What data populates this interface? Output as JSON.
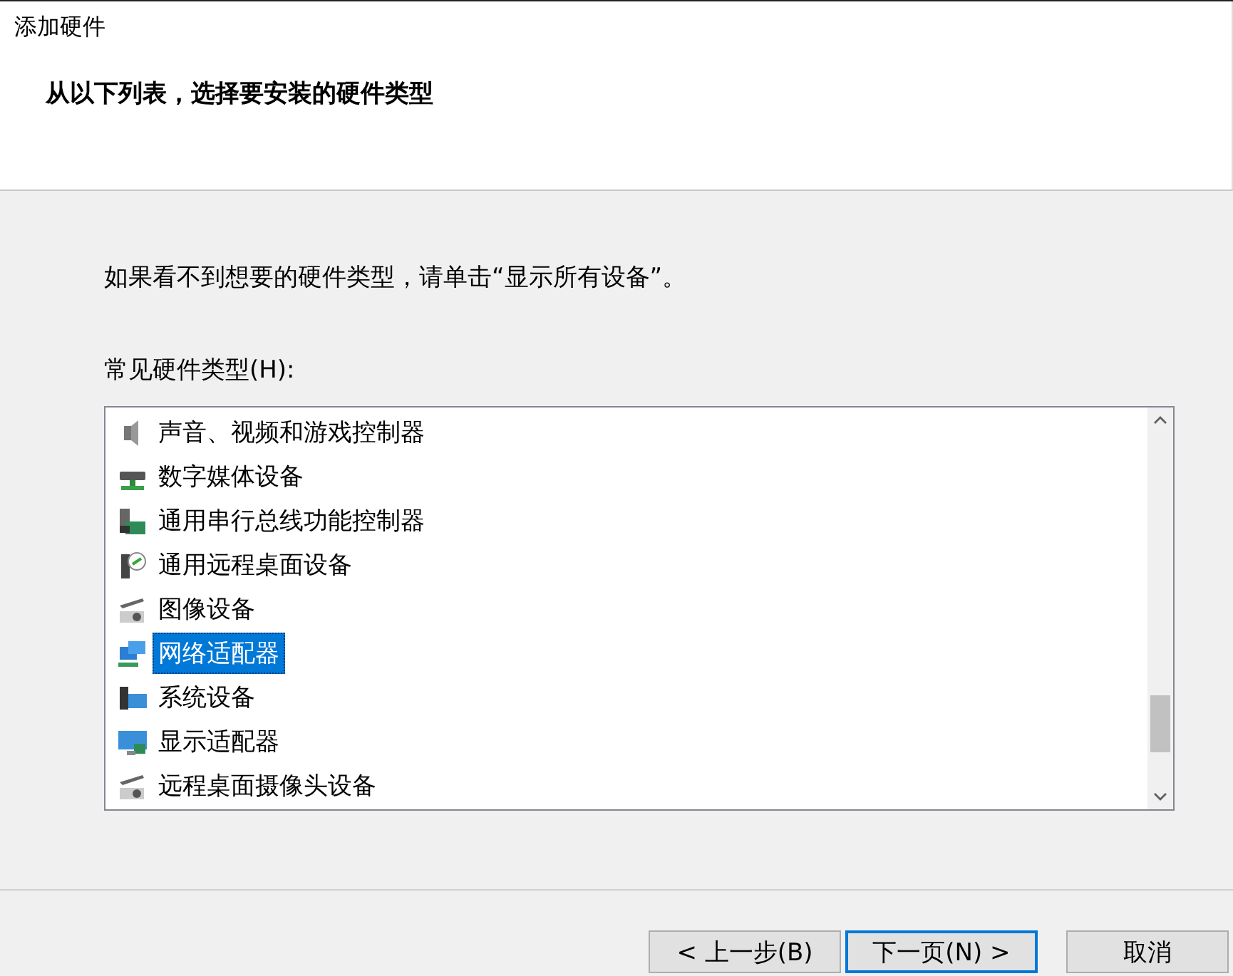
{
  "window": {
    "title": "添加硬件"
  },
  "header": {
    "heading": "从以下列表，选择要安装的硬件类型"
  },
  "hint": "如果看不到想要的硬件类型，请单击“显示所有设备”。",
  "list_label": "常见硬件类型(H):",
  "hardware_types": [
    {
      "label": "声音、视频和游戏控制器",
      "selected": false
    },
    {
      "label": "数字媒体设备",
      "selected": false
    },
    {
      "label": "通用串行总线功能控制器",
      "selected": false
    },
    {
      "label": "通用远程桌面设备",
      "selected": false
    },
    {
      "label": "图像设备",
      "selected": false
    },
    {
      "label": "网络适配器",
      "selected": true
    },
    {
      "label": "系统设备",
      "selected": false
    },
    {
      "label": "显示适配器",
      "selected": false
    },
    {
      "label": "远程桌面摄像头设备",
      "selected": false
    }
  ],
  "buttons": [
    {
      "label": "< 上一步(B)",
      "default": false
    },
    {
      "label": "下一页(N) >",
      "default": true
    },
    {
      "label": "取消",
      "default": false
    }
  ]
}
